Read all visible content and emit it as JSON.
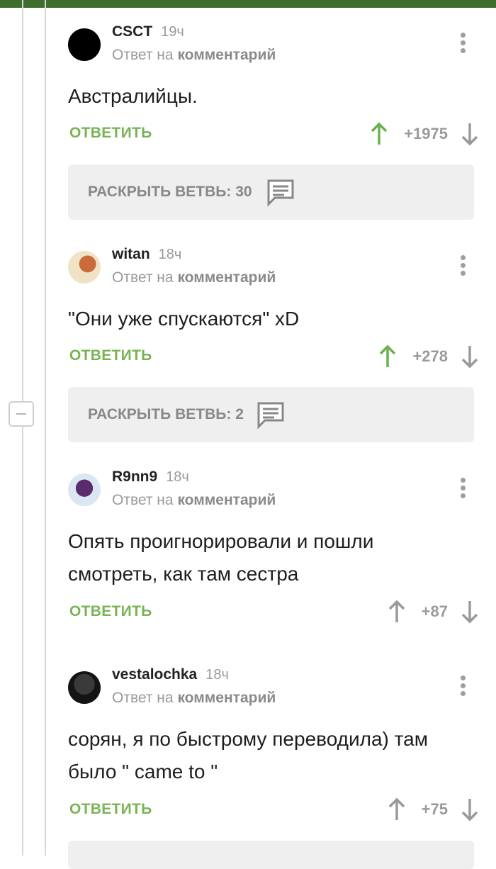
{
  "comments": [
    {
      "username": "CSCT",
      "time": "19ч",
      "reply_prefix": "Ответ на",
      "reply_link": "комментарий",
      "text_lines": [
        "Австралийцы."
      ],
      "reply_label": "ОТВЕТИТЬ",
      "score": "+1975",
      "upvoted": true
    },
    {
      "username": "witan",
      "time": "18ч",
      "reply_prefix": "Ответ на",
      "reply_link": "комментарий",
      "text_lines": [
        "\"Они уже спускаются\" xD"
      ],
      "reply_label": "ОТВЕТИТЬ",
      "score": "+278",
      "upvoted": true
    },
    {
      "username": "R9nn9",
      "time": "18ч",
      "reply_prefix": "Ответ на",
      "reply_link": "комментарий",
      "text_lines": [
        "Опять проигнорировали и пошли",
        "смотреть, как там сестра"
      ],
      "reply_label": "ОТВЕТИТЬ",
      "score": "+87",
      "upvoted": false
    },
    {
      "username": "vestalochka",
      "time": "18ч",
      "reply_prefix": "Ответ на",
      "reply_link": "комментарий",
      "text_lines": [
        "сорян, я по быстрому переводила) там",
        "было \" came to \""
      ],
      "reply_label": "ОТВЕТИТЬ",
      "score": "+75",
      "upvoted": false
    }
  ],
  "threads": [
    {
      "label": "РАСКРЫТЬ ВЕТВЬ: 30"
    },
    {
      "label": "РАСКРЫТЬ ВЕТВЬ: 2"
    }
  ],
  "colors": {
    "accent": "#7ab355",
    "upvote": "#6ab04c",
    "neutral": "#9a9a9a",
    "topbar": "#3e6d2d"
  },
  "icons": [
    "more-icon",
    "upvote-icon",
    "downvote-icon",
    "comment-bubble-icon",
    "collapse-icon"
  ]
}
